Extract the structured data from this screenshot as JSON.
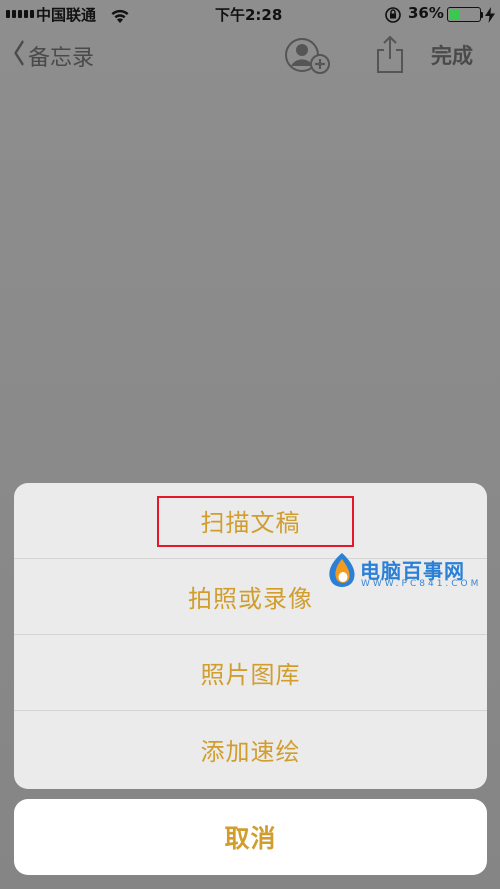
{
  "status_bar": {
    "carrier": "中国联通",
    "time": "下午2:28",
    "battery_percent": "36%",
    "battery_level": 0.36,
    "battery_color": "#39c94f",
    "icons": [
      "signal-icon",
      "wifi-icon",
      "rotation-lock-icon",
      "battery-icon",
      "charging-icon"
    ]
  },
  "nav": {
    "back_label": "备忘录",
    "done_label": "完成",
    "icons": [
      "back-chevron-icon",
      "add-person-icon",
      "share-icon"
    ]
  },
  "action_sheet": {
    "items": [
      {
        "label": "扫描文稿",
        "highlighted": true
      },
      {
        "label": "拍照或录像"
      },
      {
        "label": "照片图库"
      },
      {
        "label": "添加速绘"
      }
    ],
    "cancel_label": "取消",
    "accent_color": "#d19e2e",
    "highlight_color": "#e5172b"
  },
  "watermark": {
    "title": "电脑百事网",
    "url": "WWW.PC841.COM"
  }
}
